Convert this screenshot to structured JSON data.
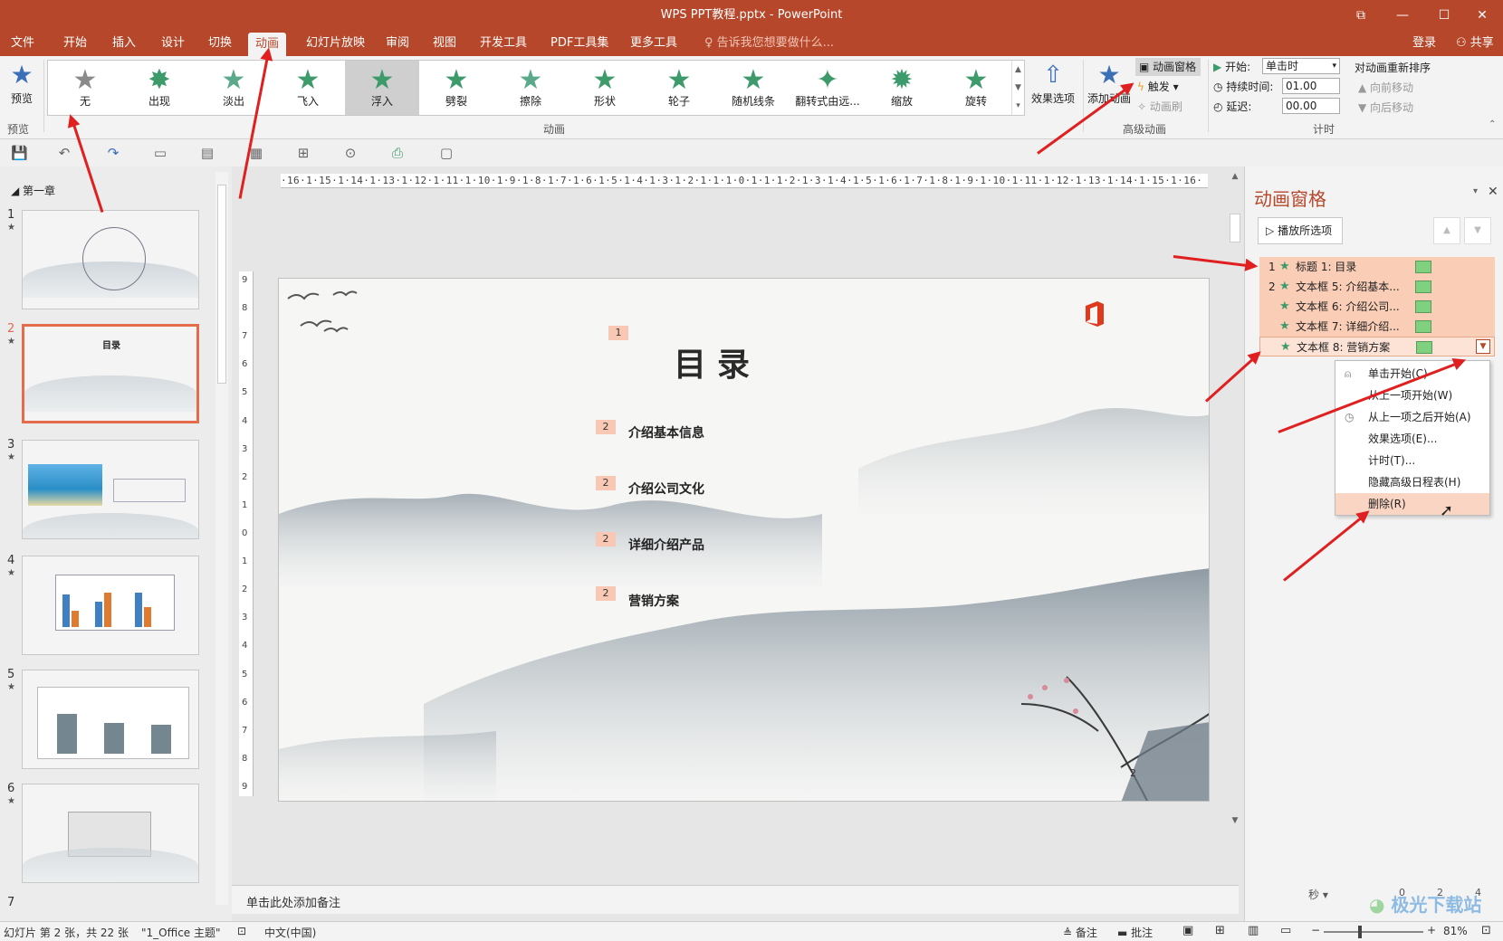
{
  "window": {
    "title": "WPS PPT教程.pptx - PowerPoint"
  },
  "menu": {
    "tabs": [
      "文件",
      "开始",
      "插入",
      "设计",
      "切换",
      "动画",
      "幻灯片放映",
      "审阅",
      "视图",
      "开发工具",
      "PDF工具集",
      "更多工具"
    ],
    "active": "动画",
    "search": "告诉我您想要做什么...",
    "login": "登录",
    "share": "共享"
  },
  "ribbon": {
    "preview": "预览",
    "preview_group": "预览",
    "animation_group": "动画",
    "animations": [
      "无",
      "出现",
      "淡出",
      "飞入",
      "浮入",
      "劈裂",
      "擦除",
      "形状",
      "轮子",
      "随机线条",
      "翻转式由远...",
      "缩放",
      "旋转"
    ],
    "selected_animation": "浮入",
    "effect_options": "效果选项",
    "add_animation": "添加动画",
    "animation_pane": "动画窗格",
    "trigger": "触发",
    "animation_painter": "动画刷",
    "advanced_group": "高级动画",
    "start_label": "开始:",
    "start_value": "单击时",
    "duration_label": "持续时间:",
    "duration_value": "01.00",
    "delay_label": "延迟:",
    "delay_value": "00.00",
    "reorder": "对动画重新排序",
    "move_earlier": "向前移动",
    "move_later": "向后移动",
    "timing_group": "计时"
  },
  "outline": {
    "section": "第一章",
    "slides": [
      1,
      2,
      3,
      4,
      5,
      6,
      7
    ],
    "selected": 2
  },
  "ruler": {
    "h": "·16·1·15·1·14·1·13·1·12·1·11·1·10·1·9·1·8·1·7·1·6·1·5·1·4·1·3·1·2·1·1·1·0·1·1·1·2·1·3·1·4·1·5·1·6·1·7·1·8·1·9·1·10·1·11·1·12·1·13·1·14·1·15·1·16·",
    "v": [
      "9",
      "8",
      "7",
      "6",
      "5",
      "4",
      "3",
      "2",
      "1",
      "0",
      "1",
      "2",
      "3",
      "4",
      "5",
      "6",
      "7",
      "8",
      "9"
    ]
  },
  "slide": {
    "title": "目录",
    "title_badge": "1",
    "items": [
      {
        "badge": "2",
        "text": "介绍基本信息"
      },
      {
        "badge": "2",
        "text": "介绍公司文化"
      },
      {
        "badge": "2",
        "text": "详细介绍产品"
      },
      {
        "badge": "2",
        "text": "营销方案"
      }
    ],
    "corner_mark": "2"
  },
  "notes": {
    "placeholder": "单击此处添加备注"
  },
  "anim_pane": {
    "title": "动画窗格",
    "play_button": "播放所选项",
    "items": [
      {
        "num": "1",
        "label": "标题 1: 目录"
      },
      {
        "num": "2",
        "label": "文本框 5: 介绍基本..."
      },
      {
        "num": "",
        "label": "文本框 6: 介绍公司..."
      },
      {
        "num": "",
        "label": "文本框 7: 详细介绍..."
      },
      {
        "num": "",
        "label": "文本框 8: 营销方案"
      }
    ],
    "seconds": "秒",
    "timeline": [
      "0",
      "2",
      "4"
    ]
  },
  "context_menu": {
    "items": [
      "单击开始(C)",
      "从上一项开始(W)",
      "从上一项之后开始(A)",
      "效果选项(E)...",
      "计时(T)...",
      "隐藏高级日程表(H)",
      "删除(R)"
    ],
    "highlighted": "删除(R)"
  },
  "status": {
    "slide_info": "幻灯片 第 2 张，共 22 张",
    "theme": "\"1_Office 主题\"",
    "language": "中文(中国)",
    "notes": "备注",
    "comments": "批注",
    "zoom": "81%"
  },
  "watermark": {
    "text": "极光下载站"
  },
  "colors": {
    "accent": "#b7472a",
    "highlight": "#f9cdb6",
    "arrow": "#e02020",
    "star": "#3d9a6a"
  }
}
